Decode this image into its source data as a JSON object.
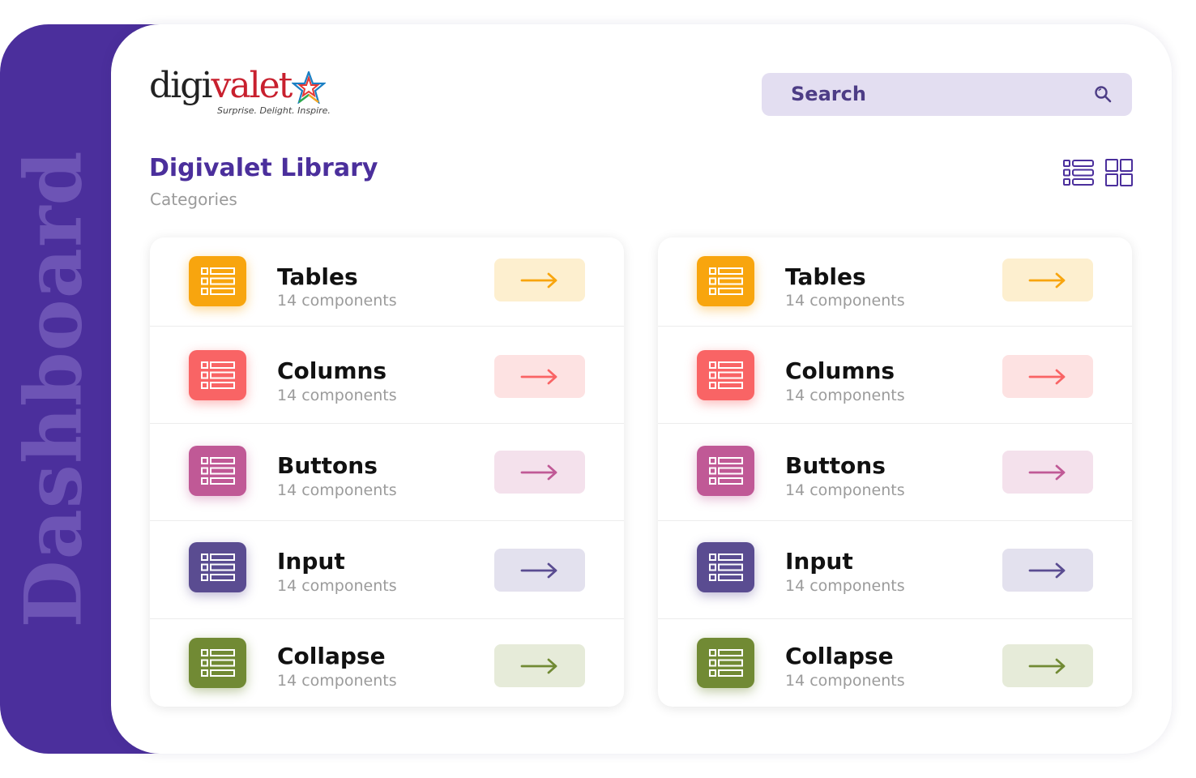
{
  "sidebar": {
    "label": "Dashboard"
  },
  "logo": {
    "brand_part_a": "digi",
    "brand_part_b": "valet",
    "tagline": "Surprise. Delight. Inspire."
  },
  "search": {
    "label": "Search",
    "icon": "search-icon"
  },
  "header": {
    "title": "Digivalet Library",
    "subtitle": "Categories"
  },
  "view_toggles": [
    {
      "icon": "list-view-icon"
    },
    {
      "icon": "grid-view-icon"
    }
  ],
  "colors": {
    "brand_purple": "#4b2f9c",
    "search_bg": "#e3def1"
  },
  "lists": [
    {
      "items": [
        {
          "name": "Tables",
          "count": "14 components",
          "color": "#f8a50e",
          "glow": "rgba(248,165,14,0.45)",
          "tint": "#fdefcf"
        },
        {
          "name": "Columns",
          "count": "14 components",
          "color": "#f96465",
          "glow": "rgba(249,100,101,0.45)",
          "tint": "#fde2e2"
        },
        {
          "name": "Buttons",
          "count": "14 components",
          "color": "#c05996",
          "glow": "rgba(192,89,150,0.40)",
          "tint": "#f4e1ec"
        },
        {
          "name": "Input",
          "count": "14 components",
          "color": "#5a4c91",
          "glow": "rgba(90,76,145,0.40)",
          "tint": "#e3e1ee"
        },
        {
          "name": "Collapse",
          "count": "14 components",
          "color": "#718a34",
          "glow": "rgba(113,138,52,0.45)",
          "tint": "#e6ebd9"
        }
      ]
    },
    {
      "items": [
        {
          "name": "Tables",
          "count": "14 components",
          "color": "#f8a50e",
          "glow": "rgba(248,165,14,0.45)",
          "tint": "#fdefcf"
        },
        {
          "name": "Columns",
          "count": "14 components",
          "color": "#f96465",
          "glow": "rgba(249,100,101,0.45)",
          "tint": "#fde2e2"
        },
        {
          "name": "Buttons",
          "count": "14 components",
          "color": "#c05996",
          "glow": "rgba(192,89,150,0.40)",
          "tint": "#f4e1ec"
        },
        {
          "name": "Input",
          "count": "14 components",
          "color": "#5a4c91",
          "glow": "rgba(90,76,145,0.40)",
          "tint": "#e3e1ee"
        },
        {
          "name": "Collapse",
          "count": "14 components",
          "color": "#718a34",
          "glow": "rgba(113,138,52,0.45)",
          "tint": "#e6ebd9"
        }
      ]
    }
  ]
}
